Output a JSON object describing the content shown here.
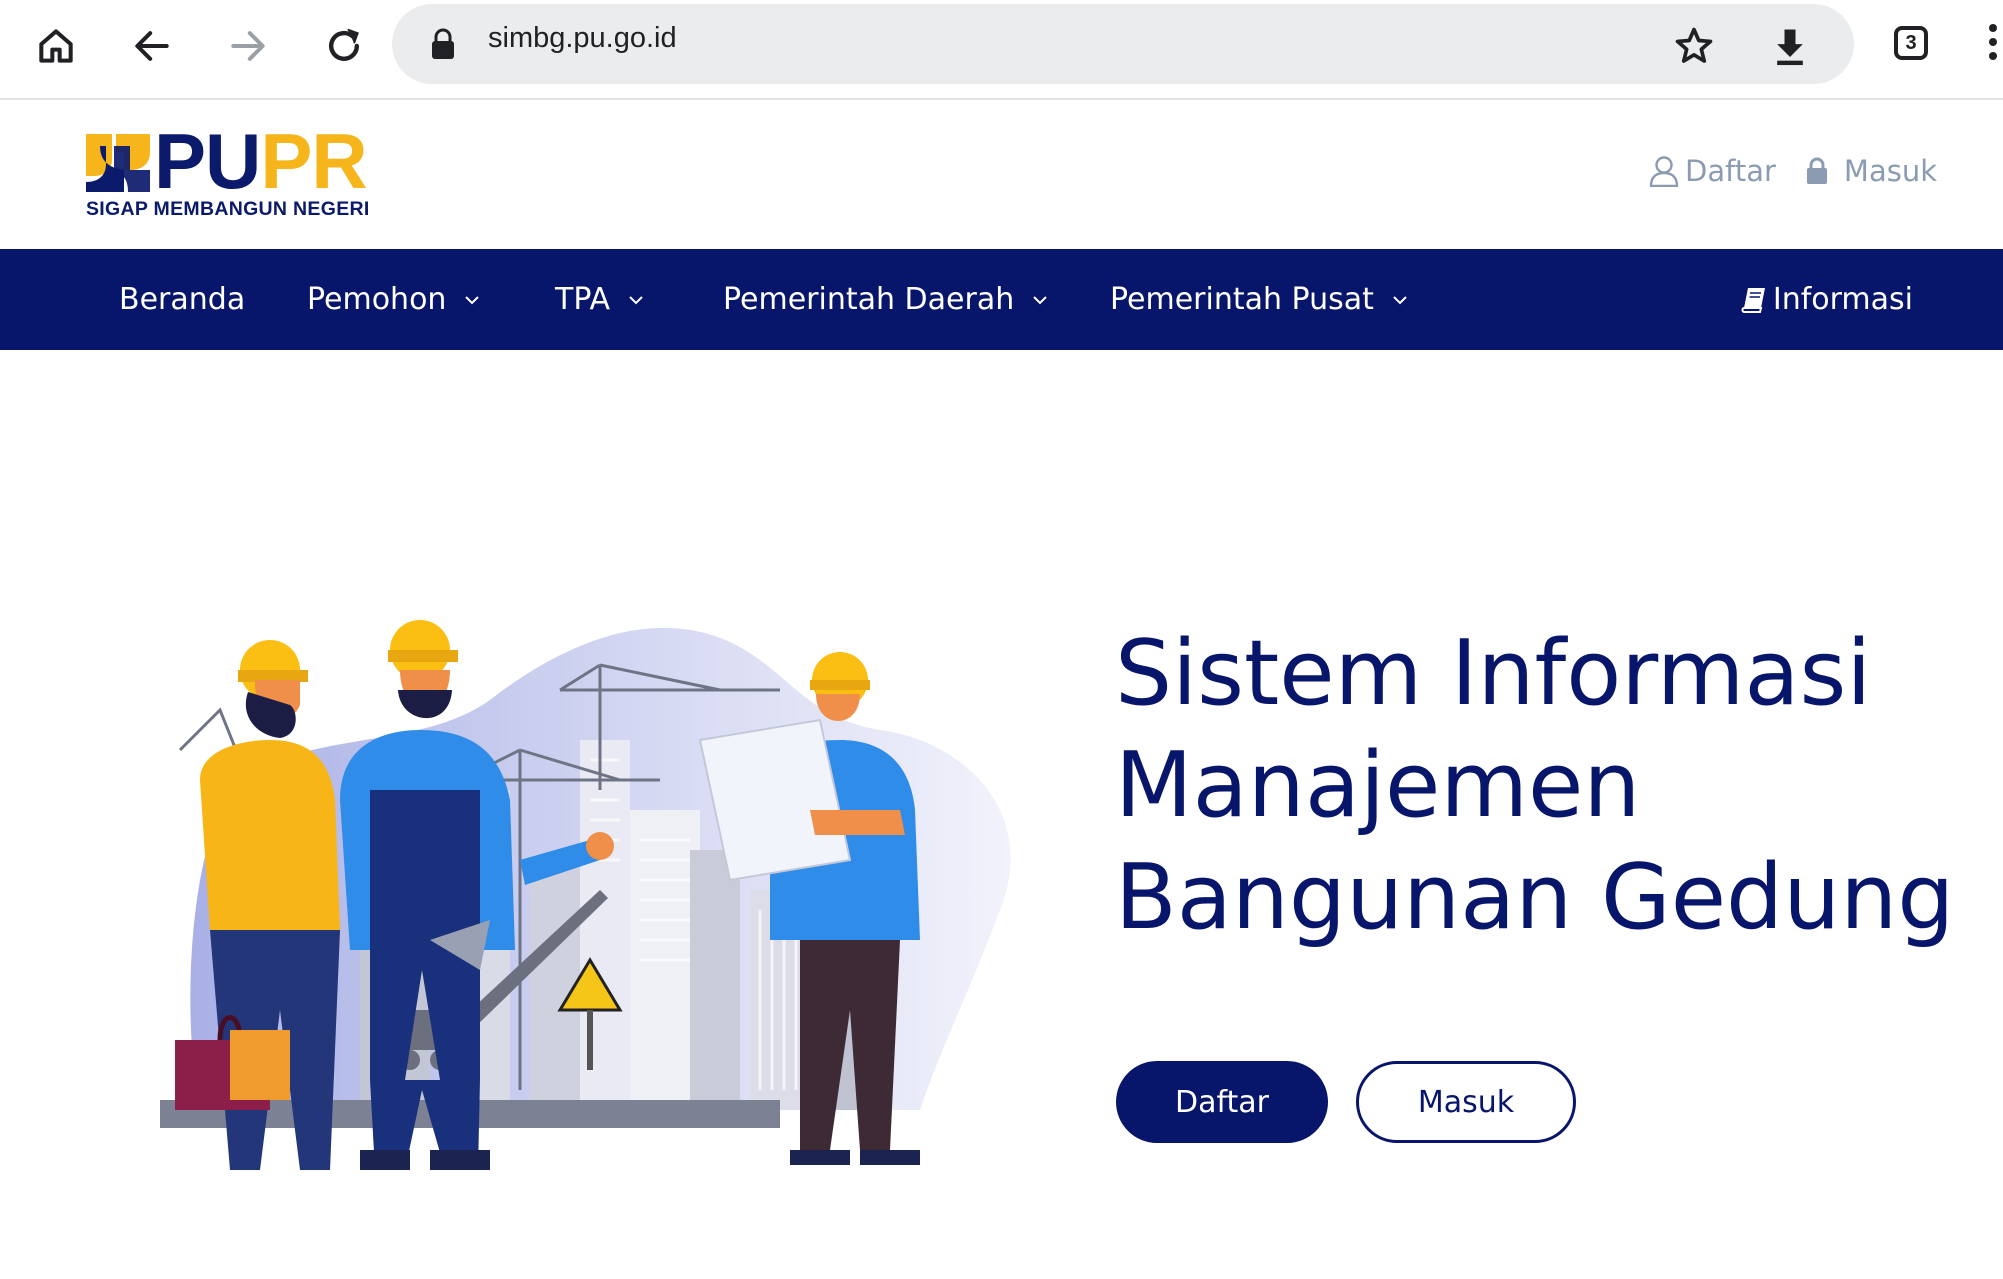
{
  "browser": {
    "url": "simbg.pu.go.id",
    "tab_count": "3"
  },
  "header": {
    "logo_part1": "PU",
    "logo_part2": "PR",
    "tagline": "SIGAP MEMBANGUN NEGERI",
    "register_label": "Daftar",
    "login_label": "Masuk"
  },
  "nav": {
    "items": [
      {
        "label": "Beranda"
      },
      {
        "label": "Pemohon"
      },
      {
        "label": "TPA"
      },
      {
        "label": "Pemerintah Daerah"
      },
      {
        "label": "Pemerintah Pusat"
      }
    ],
    "info_label": "Informasi"
  },
  "hero": {
    "title_lines": [
      "Sistem Informasi",
      "Manajemen",
      "Bangunan Gedung"
    ],
    "primary_button": "Daftar",
    "secondary_button": "Masuk"
  },
  "colors": {
    "brand_navy": "#07166a",
    "brand_yellow": "#f5b51b",
    "muted_link": "#8a9bb2"
  }
}
